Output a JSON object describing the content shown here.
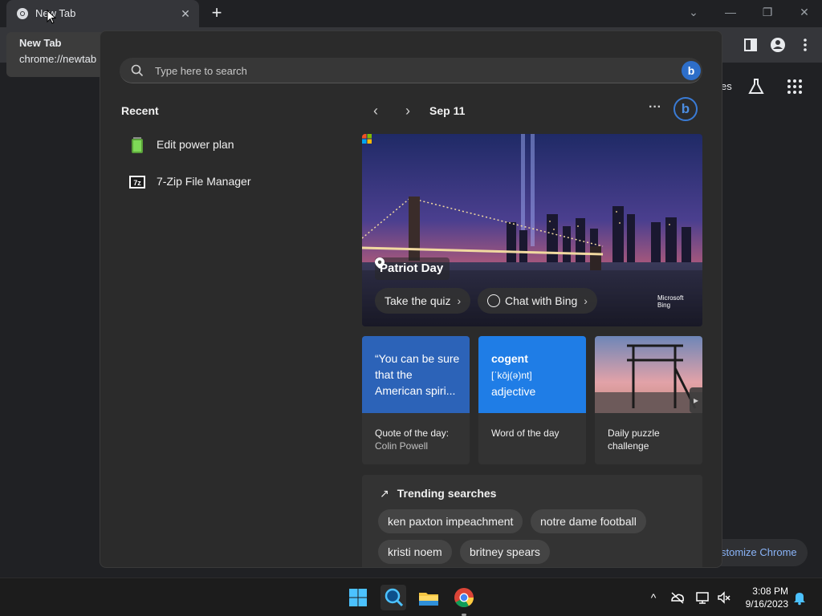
{
  "browser": {
    "tab_title": "New Tab",
    "tooltip_title": "New Tab",
    "tooltip_url": "chrome://newtab",
    "partial_link": "es",
    "customize_label": "stomize Chrome"
  },
  "search": {
    "placeholder": "Type here to search",
    "bing_label": "b"
  },
  "recent": {
    "heading": "Recent",
    "items": [
      {
        "label": "Edit power plan",
        "icon": "battery-icon"
      },
      {
        "label": "7-Zip File Manager",
        "icon": "7zip-icon"
      }
    ]
  },
  "today": {
    "date": "Sep 11",
    "more": "···",
    "hero_title": "Patriot Day",
    "quiz_label": "Take the quiz",
    "chat_label": "Chat with Bing",
    "ms_line1": "Microsoft",
    "ms_line2": "Bing"
  },
  "cards": [
    {
      "top_text": "“You can be sure that the American spiri...",
      "caption": "Quote of the day:",
      "sub": "Colin Powell"
    },
    {
      "word": "cogent",
      "phonetic": "[ˈkōj(ə)nt]",
      "pos": "adjective",
      "caption": "Word of the day"
    },
    {
      "caption": "Daily puzzle",
      "sub": "challenge"
    }
  ],
  "trending": {
    "heading": "Trending searches",
    "chips": [
      "ken paxton impeachment",
      "notre dame football",
      "kristi noem",
      "britney spears"
    ]
  },
  "taskbar": {
    "time": "3:08 PM",
    "date": "9/16/2023"
  },
  "colors": {
    "accent": "#2d6ec9",
    "word_card": "#1f7de6"
  }
}
